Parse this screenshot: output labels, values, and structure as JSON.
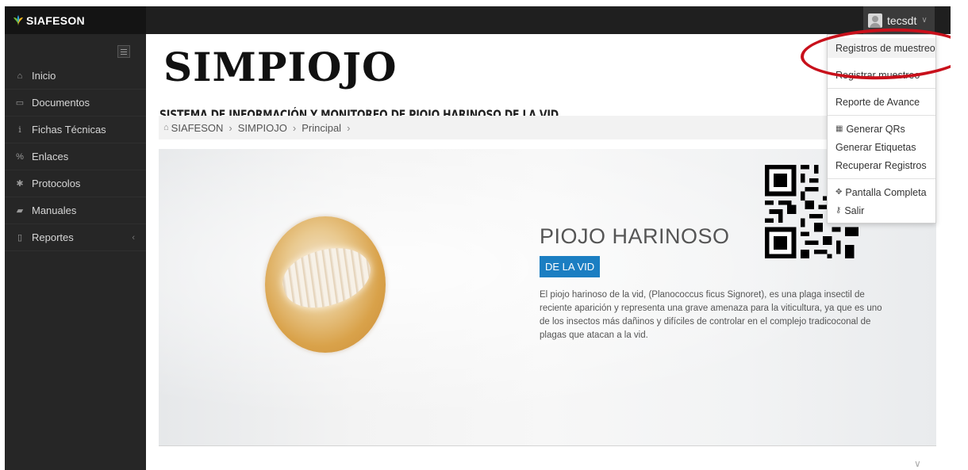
{
  "app": {
    "brand_name": "SIAFESON"
  },
  "user": {
    "name": "tecsdt"
  },
  "sidebar": {
    "items": [
      {
        "label": "Inicio",
        "icon": "home-icon"
      },
      {
        "label": "Documentos",
        "icon": "folder-icon"
      },
      {
        "label": "Fichas Técnicas",
        "icon": "info-icon"
      },
      {
        "label": "Enlaces",
        "icon": "link-icon"
      },
      {
        "label": "Protocolos",
        "icon": "gear-icon"
      },
      {
        "label": "Manuales",
        "icon": "book-icon"
      },
      {
        "label": "Reportes",
        "icon": "file-icon"
      }
    ]
  },
  "header": {
    "logo_title": "SIMPIOJO",
    "logo_subtitle": "SISTEMA DE INFORMACIÓN Y MONITOREO DE PIOJO HARINOSO DE LA VID"
  },
  "breadcrumb": {
    "items": [
      "SIAFESON",
      "SIMPIOJO",
      "Principal"
    ]
  },
  "hero": {
    "title": "PIOJO HARINOSO",
    "badge": "DE LA VID",
    "description": "El piojo harinoso de la vid, (Planococcus ficus Signoret), es una plaga insectil de reciente aparición y representa una grave amenaza para la viticultura, ya que es uno de los insectos más dañinos y difíciles de controlar en el complejo tradicoconal de plagas que atacan a la vid."
  },
  "dropdown": {
    "items": [
      {
        "label": "Registros de muestreo"
      },
      {
        "label": "Registrar muestreo"
      },
      {
        "label": "Reporte de Avance"
      },
      {
        "label": "Generar QRs",
        "icon": "qr-icon"
      },
      {
        "label": "Generar Etiquetas"
      },
      {
        "label": "Recuperar Registros"
      },
      {
        "label": "Pantalla Completa",
        "icon": "move-icon"
      },
      {
        "label": "Salir",
        "icon": "key-icon"
      }
    ]
  },
  "colors": {
    "topbar": "#1f1f1f",
    "sidebar": "#262626",
    "badge": "#1b7ec2",
    "highlight": "#c8101b"
  }
}
